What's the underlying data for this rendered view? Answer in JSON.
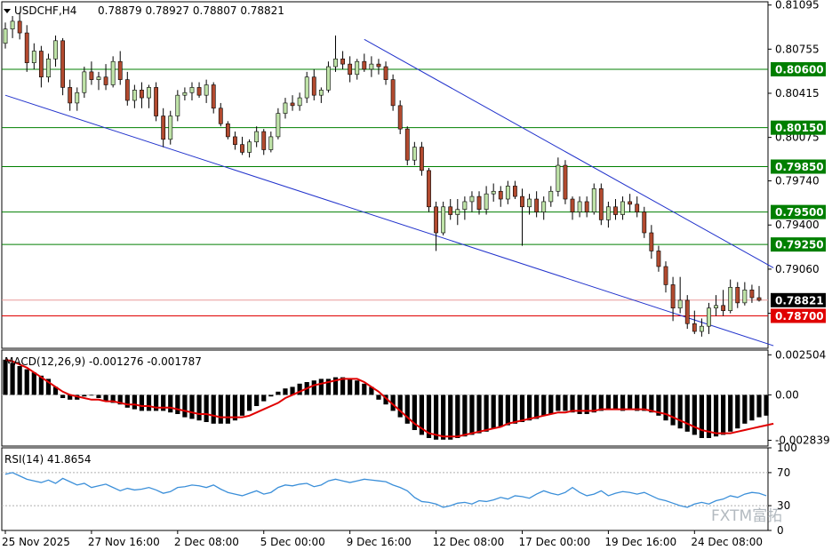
{
  "header": {
    "title": "USDCHF,H4",
    "ohlc": "0.78879 0.78927 0.78807 0.78821"
  },
  "colors": {
    "bull": "#bfe3a8",
    "bear": "#b24a2f",
    "support_line": "#007f00",
    "red_line": "#e00000",
    "channel": "#2233cc",
    "macd_signal": "#e00000",
    "rsi": "#3b8fd9",
    "price_label": "#000000",
    "level_label": "#007f00",
    "red_label": "#e00000"
  },
  "chart_data": [
    {
      "type": "candlestick",
      "symbol": "USDCHF",
      "timeframe": "H4",
      "ylim": [
        0.7845,
        0.8112
      ],
      "yticks": [
        0.81095,
        0.80755,
        0.80415,
        0.80075,
        0.7974,
        0.794,
        0.7906,
        0.7872
      ],
      "ytick_labels": [
        "0.81095",
        "0.80755",
        "0.80415",
        "0.80075",
        "0.79740",
        "0.79400",
        "0.79060",
        "0.78720"
      ],
      "current_price": {
        "value": 0.78821,
        "label": "0.78821"
      },
      "levels": [
        {
          "value": 0.806,
          "label": "0.80600",
          "color": "green"
        },
        {
          "value": 0.8015,
          "label": "0.80150",
          "color": "green"
        },
        {
          "value": 0.7985,
          "label": "0.79850",
          "color": "green"
        },
        {
          "value": 0.795,
          "label": "0.79500",
          "color": "green"
        },
        {
          "value": 0.7925,
          "label": "0.79250",
          "color": "green"
        },
        {
          "value": 0.787,
          "label": "0.78700",
          "color": "red"
        }
      ],
      "trendlines": [
        {
          "name": "",
          "x": [
            0,
            107
          ],
          "y": [
            0.804,
            0.7847
          ]
        },
        {
          "name": "",
          "x": [
            50,
            107
          ],
          "y": [
            0.8083,
            0.7907
          ]
        }
      ],
      "x_labels": [
        {
          "index": 0,
          "label": "25 Nov 2025"
        },
        {
          "index": 12,
          "label": "27 Nov 16:00"
        },
        {
          "index": 24,
          "label": "2 Dec 08:00"
        },
        {
          "index": 36,
          "label": "5 Dec 00:00"
        },
        {
          "index": 48,
          "label": "9 Dec 16:00"
        },
        {
          "index": 60,
          "label": "12 Dec 08:00"
        },
        {
          "index": 72,
          "label": "17 Dec 00:00"
        },
        {
          "index": 84,
          "label": "19 Dec 16:00"
        },
        {
          "index": 96,
          "label": "24 Dec 08:00"
        }
      ],
      "candles": [
        [
          0.808,
          0.8096,
          0.8076,
          0.8091
        ],
        [
          0.8091,
          0.8101,
          0.8084,
          0.8097
        ],
        [
          0.8097,
          0.8104,
          0.8083,
          0.8088
        ],
        [
          0.8088,
          0.8094,
          0.8058,
          0.8065
        ],
        [
          0.8065,
          0.808,
          0.806,
          0.8074
        ],
        [
          0.8074,
          0.8078,
          0.8046,
          0.8054
        ],
        [
          0.8054,
          0.8072,
          0.805,
          0.8068
        ],
        [
          0.8068,
          0.8086,
          0.8062,
          0.8082
        ],
        [
          0.8082,
          0.8084,
          0.804,
          0.8046
        ],
        [
          0.8046,
          0.8052,
          0.8028,
          0.8034
        ],
        [
          0.8034,
          0.8046,
          0.8028,
          0.8042
        ],
        [
          0.8042,
          0.8062,
          0.8038,
          0.8058
        ],
        [
          0.8058,
          0.8066,
          0.8048,
          0.8052
        ],
        [
          0.8052,
          0.8058,
          0.8044,
          0.8054
        ],
        [
          0.8054,
          0.8064,
          0.8044,
          0.8048
        ],
        [
          0.8048,
          0.807,
          0.8046,
          0.8066
        ],
        [
          0.8066,
          0.8074,
          0.8048,
          0.8052
        ],
        [
          0.8052,
          0.8058,
          0.8032,
          0.8036
        ],
        [
          0.8036,
          0.8048,
          0.803,
          0.8044
        ],
        [
          0.8044,
          0.805,
          0.803,
          0.8038
        ],
        [
          0.8038,
          0.8048,
          0.803,
          0.8046
        ],
        [
          0.8046,
          0.805,
          0.802,
          0.8024
        ],
        [
          0.8024,
          0.803,
          0.8,
          0.8006
        ],
        [
          0.8006,
          0.8028,
          0.8002,
          0.8024
        ],
        [
          0.8024,
          0.8044,
          0.802,
          0.804
        ],
        [
          0.804,
          0.8046,
          0.8036,
          0.8042
        ],
        [
          0.8042,
          0.805,
          0.8036,
          0.8046
        ],
        [
          0.8046,
          0.805,
          0.8038,
          0.804
        ],
        [
          0.804,
          0.8052,
          0.8034,
          0.8048
        ],
        [
          0.8048,
          0.805,
          0.8026,
          0.803
        ],
        [
          0.803,
          0.8034,
          0.8016,
          0.8018
        ],
        [
          0.8018,
          0.802,
          0.8006,
          0.8008
        ],
        [
          0.8008,
          0.8012,
          0.7998,
          0.8002
        ],
        [
          0.8002,
          0.8008,
          0.7994,
          0.7996
        ],
        [
          0.7996,
          0.8006,
          0.7992,
          0.8004
        ],
        [
          0.8004,
          0.8016,
          0.8,
          0.8012
        ],
        [
          0.8012,
          0.8014,
          0.7994,
          0.7998
        ],
        [
          0.7998,
          0.8012,
          0.7996,
          0.8008
        ],
        [
          0.8008,
          0.803,
          0.8006,
          0.8026
        ],
        [
          0.8026,
          0.8038,
          0.8022,
          0.8034
        ],
        [
          0.8034,
          0.804,
          0.8028,
          0.8032
        ],
        [
          0.8032,
          0.8042,
          0.8028,
          0.8038
        ],
        [
          0.8038,
          0.8058,
          0.8034,
          0.8054
        ],
        [
          0.8054,
          0.806,
          0.8036,
          0.804
        ],
        [
          0.804,
          0.8046,
          0.8034,
          0.8044
        ],
        [
          0.8044,
          0.8066,
          0.8042,
          0.8062
        ],
        [
          0.8062,
          0.8086,
          0.8058,
          0.8068
        ],
        [
          0.8068,
          0.8074,
          0.806,
          0.8064
        ],
        [
          0.8064,
          0.807,
          0.805,
          0.8056
        ],
        [
          0.8056,
          0.8068,
          0.8052,
          0.8066
        ],
        [
          0.8066,
          0.8072,
          0.8058,
          0.806
        ],
        [
          0.806,
          0.807,
          0.8054,
          0.8064
        ],
        [
          0.8064,
          0.8068,
          0.8056,
          0.8062
        ],
        [
          0.8062,
          0.8066,
          0.8048,
          0.8052
        ],
        [
          0.8052,
          0.8056,
          0.8028,
          0.8032
        ],
        [
          0.8032,
          0.8036,
          0.801,
          0.8014
        ],
        [
          0.8014,
          0.8016,
          0.7986,
          0.799
        ],
        [
          0.799,
          0.8004,
          0.7986,
          0.8
        ],
        [
          0.8,
          0.8004,
          0.7978,
          0.7982
        ],
        [
          0.7982,
          0.7984,
          0.795,
          0.7954
        ],
        [
          0.7954,
          0.7958,
          0.792,
          0.7934
        ],
        [
          0.7934,
          0.7958,
          0.7932,
          0.7954
        ],
        [
          0.7954,
          0.796,
          0.7944,
          0.7948
        ],
        [
          0.7948,
          0.796,
          0.794,
          0.7952
        ],
        [
          0.7952,
          0.7962,
          0.7944,
          0.7958
        ],
        [
          0.7958,
          0.7966,
          0.795,
          0.7962
        ],
        [
          0.7962,
          0.7966,
          0.7948,
          0.7952
        ],
        [
          0.7952,
          0.797,
          0.7948,
          0.7964
        ],
        [
          0.7964,
          0.7972,
          0.7958,
          0.7966
        ],
        [
          0.7966,
          0.797,
          0.7954,
          0.796
        ],
        [
          0.796,
          0.7974,
          0.7956,
          0.797
        ],
        [
          0.797,
          0.7974,
          0.796,
          0.7962
        ],
        [
          0.7962,
          0.7968,
          0.7924,
          0.7954
        ],
        [
          0.7954,
          0.7964,
          0.7948,
          0.796
        ],
        [
          0.796,
          0.7966,
          0.7946,
          0.795
        ],
        [
          0.795,
          0.7962,
          0.7944,
          0.7958
        ],
        [
          0.7958,
          0.797,
          0.7954,
          0.7966
        ],
        [
          0.7966,
          0.7992,
          0.7962,
          0.7986
        ],
        [
          0.7986,
          0.799,
          0.7956,
          0.796
        ],
        [
          0.796,
          0.7962,
          0.7944,
          0.795
        ],
        [
          0.795,
          0.7962,
          0.7946,
          0.7958
        ],
        [
          0.7958,
          0.7962,
          0.7946,
          0.795
        ],
        [
          0.795,
          0.7972,
          0.7948,
          0.7968
        ],
        [
          0.7968,
          0.7972,
          0.794,
          0.7944
        ],
        [
          0.7944,
          0.7958,
          0.7938,
          0.7954
        ],
        [
          0.7954,
          0.796,
          0.7944,
          0.7948
        ],
        [
          0.7948,
          0.7962,
          0.7944,
          0.7958
        ],
        [
          0.7958,
          0.7964,
          0.795,
          0.7956
        ],
        [
          0.7956,
          0.7962,
          0.7946,
          0.795
        ],
        [
          0.795,
          0.7954,
          0.793,
          0.7934
        ],
        [
          0.7934,
          0.794,
          0.7914,
          0.792
        ],
        [
          0.792,
          0.7924,
          0.7904,
          0.7908
        ],
        [
          0.7908,
          0.7912,
          0.7888,
          0.7894
        ],
        [
          0.7894,
          0.79,
          0.7866,
          0.7876
        ],
        [
          0.7876,
          0.79,
          0.7872,
          0.7882
        ],
        [
          0.7882,
          0.7886,
          0.786,
          0.7864
        ],
        [
          0.7864,
          0.7874,
          0.7856,
          0.7858
        ],
        [
          0.7858,
          0.7868,
          0.7854,
          0.7862
        ],
        [
          0.7862,
          0.788,
          0.7856,
          0.7876
        ],
        [
          0.7876,
          0.7886,
          0.787,
          0.7878
        ],
        [
          0.7878,
          0.789,
          0.787,
          0.7874
        ],
        [
          0.7874,
          0.7898,
          0.7872,
          0.7892
        ],
        [
          0.7892,
          0.7896,
          0.7876,
          0.788
        ],
        [
          0.788,
          0.7896,
          0.7878,
          0.789
        ],
        [
          0.789,
          0.7894,
          0.788,
          0.7884
        ],
        [
          0.7884,
          0.7893,
          0.7881,
          0.7882
        ]
      ]
    },
    {
      "type": "bar",
      "title": "MACD(12,26,9) -0.001276 -0.001787",
      "ylim": [
        -0.0032,
        0.0028
      ],
      "yticks": [
        0.002504,
        0.0,
        -0.002839
      ],
      "ytick_labels": [
        "0.002504",
        "0.00",
        "-0.002839"
      ],
      "histogram": [
        0.0022,
        0.002,
        0.0018,
        0.0016,
        0.0014,
        0.0012,
        0.001,
        0.0005,
        -0.0002,
        -0.0003,
        -0.0003,
        -0.0001,
        0.0,
        -0.0002,
        -0.0004,
        -0.0005,
        -0.0006,
        -0.0008,
        -0.0009,
        -0.001,
        -0.001,
        -0.001,
        -0.001,
        -0.0011,
        -0.0012,
        -0.0014,
        -0.0015,
        -0.0016,
        -0.0017,
        -0.0018,
        -0.0018,
        -0.0018,
        -0.0016,
        -0.0013,
        -0.001,
        -0.0007,
        -0.0004,
        -0.0001,
        0.0002,
        0.0004,
        0.0005,
        0.0007,
        0.0008,
        0.0009,
        0.001,
        0.001,
        0.0011,
        0.0011,
        0.001,
        0.0009,
        0.0007,
        0.0005,
        -0.0003,
        -0.0006,
        -0.001,
        -0.0014,
        -0.0018,
        -0.0022,
        -0.0025,
        -0.0027,
        -0.0028,
        -0.0028,
        -0.0028,
        -0.0027,
        -0.0026,
        -0.0025,
        -0.0024,
        -0.0023,
        -0.0021,
        -0.002,
        -0.0019,
        -0.0018,
        -0.0017,
        -0.0016,
        -0.0015,
        -0.0013,
        -0.0012,
        -0.001,
        -0.001,
        -0.0011,
        -0.0012,
        -0.0012,
        -0.0011,
        -0.001,
        -0.0009,
        -0.0009,
        -0.001,
        -0.0009,
        -0.001,
        -0.001,
        -0.0011,
        -0.0013,
        -0.0016,
        -0.0019,
        -0.0021,
        -0.0023,
        -0.0025,
        -0.0027,
        -0.0027,
        -0.0026,
        -0.0025,
        -0.0023,
        -0.0021,
        -0.0018,
        -0.0016,
        -0.0014,
        -0.0013
      ],
      "signal": [
        0.0022,
        0.0021,
        0.0019,
        0.0017,
        0.0014,
        0.0011,
        0.0008,
        0.0005,
        0.0002,
        0.0,
        -0.0001,
        -0.0002,
        -0.0003,
        -0.0003,
        -0.0004,
        -0.0004,
        -0.0005,
        -0.0006,
        -0.0006,
        -0.0007,
        -0.0007,
        -0.0008,
        -0.0008,
        -0.0008,
        -0.0009,
        -0.001,
        -0.0011,
        -0.0012,
        -0.0012,
        -0.0013,
        -0.0014,
        -0.0014,
        -0.0014,
        -0.0014,
        -0.0013,
        -0.0011,
        -0.0009,
        -0.0007,
        -0.0005,
        -0.0002,
        0.0,
        0.0002,
        0.0004,
        0.0006,
        0.0007,
        0.0008,
        0.0009,
        0.001,
        0.001,
        0.001,
        0.0008,
        0.0005,
        0.0002,
        -0.0002,
        -0.0006,
        -0.001,
        -0.0014,
        -0.0018,
        -0.0021,
        -0.0024,
        -0.0025,
        -0.0026,
        -0.0026,
        -0.0026,
        -0.0025,
        -0.0024,
        -0.0023,
        -0.0022,
        -0.0021,
        -0.002,
        -0.0018,
        -0.0017,
        -0.0016,
        -0.0015,
        -0.0014,
        -0.0013,
        -0.0012,
        -0.0011,
        -0.0011,
        -0.001,
        -0.001,
        -0.001,
        -0.001,
        -0.0009,
        -0.0009,
        -0.0009,
        -0.0009,
        -0.0009,
        -0.0009,
        -0.0009,
        -0.001,
        -0.0011,
        -0.0012,
        -0.0014,
        -0.0016,
        -0.0018,
        -0.002,
        -0.0022,
        -0.0023,
        -0.0024,
        -0.0024,
        -0.0024,
        -0.0023,
        -0.0022,
        -0.0021,
        -0.002,
        -0.0019,
        -0.0018
      ]
    },
    {
      "type": "line",
      "title": "RSI(14) 41.8654",
      "ylim": [
        0,
        100
      ],
      "yticks": [
        100,
        70,
        30,
        0
      ],
      "ytick_labels": [
        "100",
        "70",
        "30",
        "0"
      ],
      "levels": [
        70,
        30
      ],
      "values": [
        68,
        70,
        66,
        62,
        60,
        58,
        61,
        57,
        63,
        59,
        55,
        57,
        52,
        54,
        56,
        52,
        48,
        51,
        49,
        50,
        52,
        49,
        45,
        47,
        52,
        53,
        55,
        54,
        52,
        55,
        50,
        46,
        44,
        42,
        45,
        48,
        44,
        46,
        52,
        55,
        54,
        56,
        57,
        53,
        55,
        60,
        62,
        60,
        58,
        60,
        62,
        61,
        60,
        59,
        55,
        52,
        48,
        40,
        35,
        34,
        32,
        28,
        30,
        33,
        34,
        32,
        36,
        35,
        37,
        40,
        38,
        42,
        41,
        39,
        44,
        48,
        45,
        43,
        46,
        52,
        46,
        42,
        44,
        48,
        42,
        45,
        47,
        46,
        44,
        46,
        42,
        38,
        36,
        33,
        30,
        28,
        32,
        34,
        32,
        36,
        38,
        42,
        40,
        44,
        46,
        45,
        42
      ]
    }
  ],
  "watermark": {
    "text": "FXTM富拓"
  }
}
